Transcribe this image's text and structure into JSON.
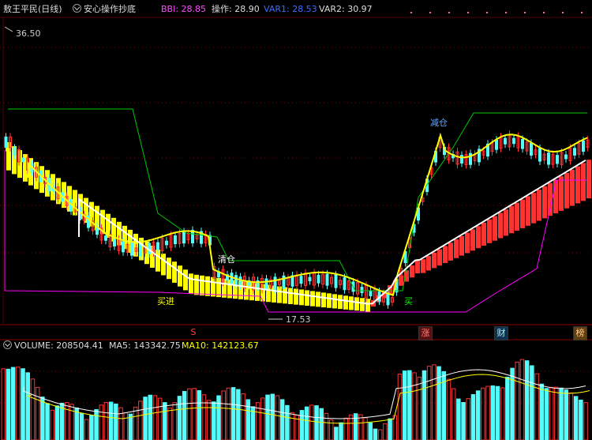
{
  "header": {
    "stock_name": "敖王平民(日线)",
    "indicator_name": "安心操作抄底",
    "bbi_label": "BBI: 28.85",
    "caozuo_label": "操作: 28.90",
    "var1_label": "VAR1: 28.53",
    "var2_label": "VAR2: 30.97"
  },
  "main": {
    "high_label": "36.50",
    "low_label": "17.53",
    "annotations": {
      "qingcang": "清仓",
      "mairu_jin": "买进",
      "mai": "买",
      "jiancang": "减仓"
    }
  },
  "tags": {
    "s_tag": "S",
    "zhang_tag": "涨",
    "cai_tag": "财",
    "bang_tag": "榜"
  },
  "volume": {
    "volume_label": "VOLUME: 208504.41",
    "ma5_label": "MA5: 143342.75",
    "ma10_label": "MA10: 142123.67"
  },
  "colors": {
    "up": "#ff3232",
    "down": "#54fcfc",
    "yellow": "#ffff00",
    "green_line": "#00c800",
    "magenta": "#ff00ff",
    "white": "#ffffff",
    "grid": "#8b0000"
  }
}
